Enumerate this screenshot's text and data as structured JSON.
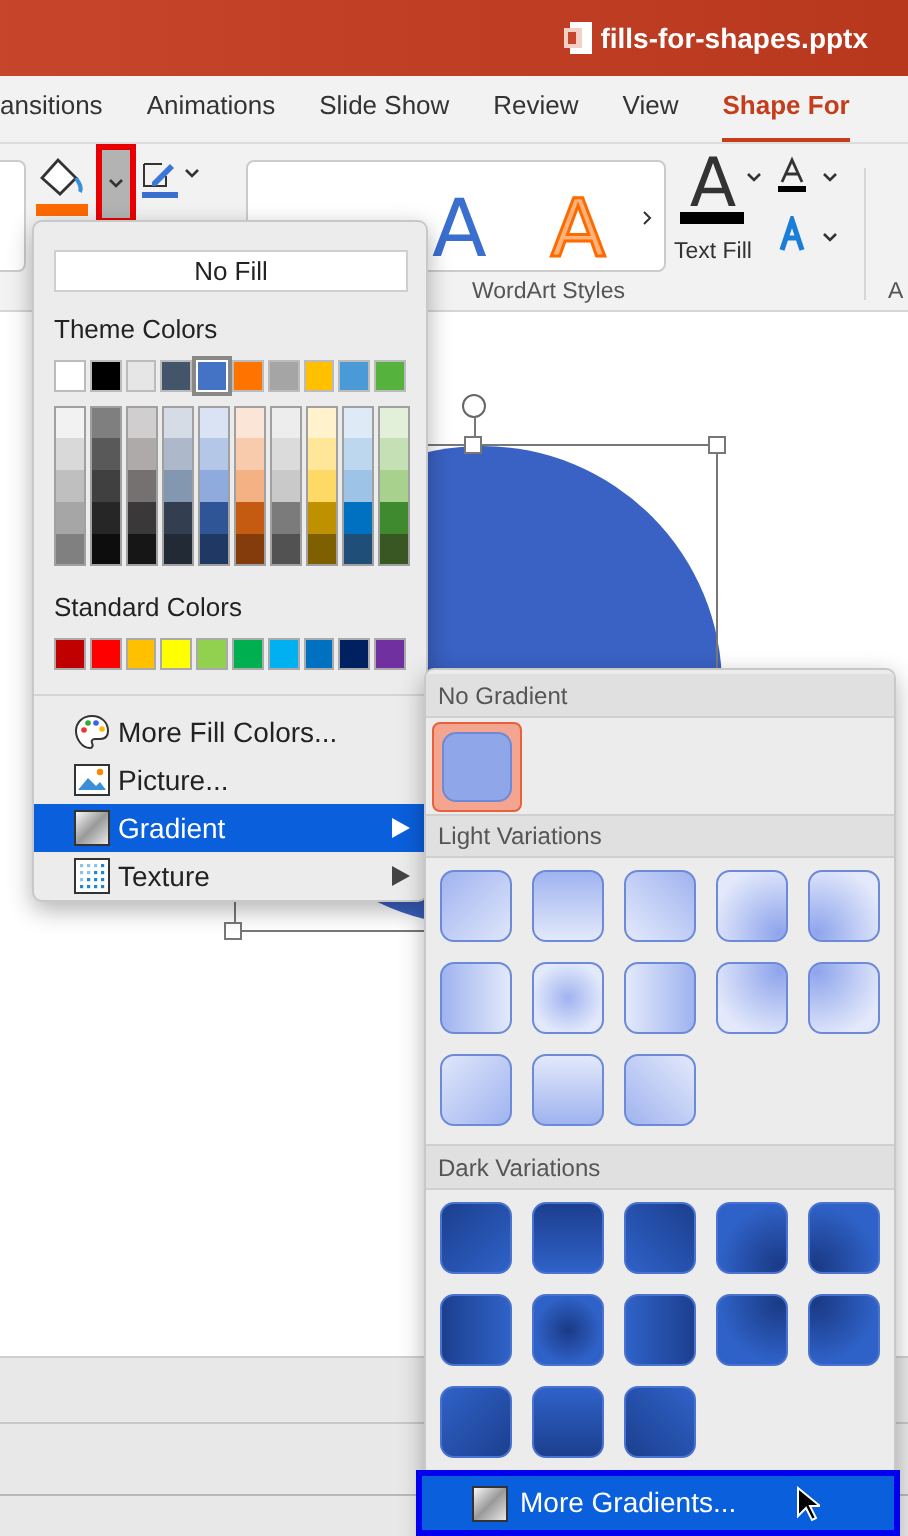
{
  "window": {
    "title": "fills-for-shapes.pptx"
  },
  "tabs": [
    {
      "label": "ansitions",
      "selected": false
    },
    {
      "label": "Animations",
      "selected": false
    },
    {
      "label": "Slide Show",
      "selected": false
    },
    {
      "label": "Review",
      "selected": false
    },
    {
      "label": "View",
      "selected": false
    },
    {
      "label": "Shape For",
      "selected": true
    }
  ],
  "ribbon": {
    "wordart_group": "WordArt Styles",
    "text_fill": "Text Fill",
    "text_fill_glyph": "A",
    "next_group": "A",
    "gallery_letters": [
      {
        "text": "A",
        "kind": "blue"
      },
      {
        "text": "A",
        "kind": "orange"
      }
    ]
  },
  "fill_menu": {
    "no_fill": "No Fill",
    "theme_label": "Theme Colors",
    "theme_colors": [
      {
        "color": "#ffffff",
        "selected": false
      },
      {
        "color": "#000000",
        "selected": false
      },
      {
        "color": "#e7e6e6",
        "selected": false
      },
      {
        "color": "#44546a",
        "selected": false
      },
      {
        "color": "#4472c4",
        "selected": true
      },
      {
        "color": "#ff7300",
        "selected": false
      },
      {
        "color": "#a5a5a5",
        "selected": false
      },
      {
        "color": "#ffc000",
        "selected": false
      },
      {
        "color": "#4a9ad8",
        "selected": false
      },
      {
        "color": "#55b33d",
        "selected": false
      }
    ],
    "shade_columns": [
      {
        "shades": [
          {
            "color": "#f2f2f2"
          },
          {
            "color": "#d9d9d9"
          },
          {
            "color": "#bfbfbf"
          },
          {
            "color": "#a6a6a6"
          },
          {
            "color": "#808080"
          }
        ]
      },
      {
        "shades": [
          {
            "color": "#7f7f7f"
          },
          {
            "color": "#595959"
          },
          {
            "color": "#404040"
          },
          {
            "color": "#262626"
          },
          {
            "color": "#0d0d0d"
          }
        ]
      },
      {
        "shades": [
          {
            "color": "#d0cece"
          },
          {
            "color": "#aeaaaa"
          },
          {
            "color": "#757171"
          },
          {
            "color": "#3a3838"
          },
          {
            "color": "#171616"
          }
        ]
      },
      {
        "shades": [
          {
            "color": "#d6dce5"
          },
          {
            "color": "#adb9ca"
          },
          {
            "color": "#8497b0"
          },
          {
            "color": "#333f50"
          },
          {
            "color": "#222a35"
          }
        ]
      },
      {
        "shades": [
          {
            "color": "#dae3f3"
          },
          {
            "color": "#b4c7e7"
          },
          {
            "color": "#8faadc"
          },
          {
            "color": "#2f5597"
          },
          {
            "color": "#1f3864"
          }
        ]
      },
      {
        "shades": [
          {
            "color": "#fbe5d6"
          },
          {
            "color": "#f8cbad"
          },
          {
            "color": "#f4b183"
          },
          {
            "color": "#c55a11"
          },
          {
            "color": "#843c0c"
          }
        ]
      },
      {
        "shades": [
          {
            "color": "#ededed"
          },
          {
            "color": "#dbdbdb"
          },
          {
            "color": "#c9c9c9"
          },
          {
            "color": "#7b7b7b"
          },
          {
            "color": "#525252"
          }
        ]
      },
      {
        "shades": [
          {
            "color": "#fff2cc"
          },
          {
            "color": "#ffe699"
          },
          {
            "color": "#ffd966"
          },
          {
            "color": "#bf9000"
          },
          {
            "color": "#7f6000"
          }
        ]
      },
      {
        "shades": [
          {
            "color": "#deebf7"
          },
          {
            "color": "#bdd7ee"
          },
          {
            "color": "#9dc3e6"
          },
          {
            "color": "#0070c0"
          },
          {
            "color": "#1f4e79"
          }
        ]
      },
      {
        "shades": [
          {
            "color": "#e2f0d9"
          },
          {
            "color": "#c5e0b4"
          },
          {
            "color": "#a9d18e"
          },
          {
            "color": "#3f8a2f"
          },
          {
            "color": "#385723"
          }
        ]
      }
    ],
    "standard_label": "Standard Colors",
    "standard_colors": [
      {
        "color": "#c00000"
      },
      {
        "color": "#ff0000"
      },
      {
        "color": "#ffc000"
      },
      {
        "color": "#ffff00"
      },
      {
        "color": "#92d050"
      },
      {
        "color": "#00b050"
      },
      {
        "color": "#00b0f0"
      },
      {
        "color": "#0070c0"
      },
      {
        "color": "#002060"
      },
      {
        "color": "#7030a0"
      }
    ],
    "items": [
      {
        "label": "More Fill Colors...",
        "kind": "palette",
        "selected": false,
        "submenu": false
      },
      {
        "label": "Picture...",
        "kind": "picture",
        "selected": false,
        "submenu": false
      },
      {
        "label": "Gradient",
        "kind": "gradient",
        "selected": true,
        "submenu": true
      },
      {
        "label": "Texture",
        "kind": "texture",
        "selected": false,
        "submenu": true
      }
    ]
  },
  "gradient_menu": {
    "no_gradient_label": "No Gradient",
    "no_gradient": {
      "selected": true
    },
    "light_label": "Light Variations",
    "light": [
      {
        "selected": false
      },
      {
        "selected": false
      },
      {
        "selected": false
      },
      {
        "selected": false
      },
      {
        "selected": false
      },
      {
        "selected": false
      },
      {
        "selected": false
      },
      {
        "selected": false
      },
      {
        "selected": false
      },
      {
        "selected": false
      },
      {
        "selected": false
      },
      {
        "selected": false
      },
      {
        "selected": false
      }
    ],
    "dark_label": "Dark Variations",
    "dark": [
      {
        "selected": false
      },
      {
        "selected": false
      },
      {
        "selected": false
      },
      {
        "selected": false
      },
      {
        "selected": false
      },
      {
        "selected": false
      },
      {
        "selected": false
      },
      {
        "selected": false
      },
      {
        "selected": false
      },
      {
        "selected": false
      },
      {
        "selected": false
      },
      {
        "selected": false
      },
      {
        "selected": false
      }
    ],
    "more": {
      "label": "More Gradients...",
      "selected": true
    }
  }
}
